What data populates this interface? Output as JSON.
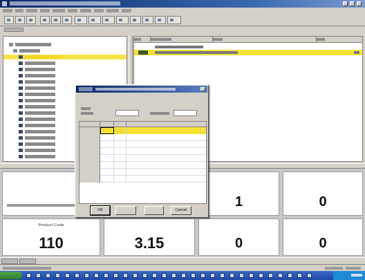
{
  "window": {
    "title": ""
  },
  "menu": {
    "items": [
      "",
      "",
      "",
      "",
      "",
      "",
      "",
      "",
      "",
      ""
    ]
  },
  "tree": {
    "root_label": "",
    "child_label": "",
    "items": [
      "",
      "",
      "",
      "",
      "",
      "",
      "",
      "",
      "",
      "",
      "",
      "",
      "",
      "",
      "",
      "",
      ""
    ],
    "selected_index": 0
  },
  "list": {
    "columns": [
      "",
      "",
      "",
      ""
    ],
    "rows": [
      {
        "text": "",
        "selected": false
      },
      {
        "text": "",
        "selected": true
      }
    ]
  },
  "panels": [
    {
      "title": "",
      "value": "",
      "subtitle": ""
    },
    {
      "title": "",
      "value": ""
    },
    {
      "title": "",
      "value": "1"
    },
    {
      "title": "",
      "value": "0"
    },
    {
      "title": "Product Code",
      "value": "110"
    },
    {
      "title": "",
      "value": "3.15"
    },
    {
      "title": "",
      "value": "0"
    },
    {
      "title": "",
      "value": "0"
    }
  ],
  "dialog": {
    "title": "",
    "label_address": "",
    "label_quantity": "",
    "address_value": "",
    "quantity_value": "",
    "grid": {
      "columns": [
        "",
        "",
        ""
      ],
      "row_labels": [
        "",
        "",
        "",
        "",
        "",
        "",
        "",
        ""
      ],
      "selected_row": 0
    },
    "buttons": {
      "ok": "OK",
      "second": "",
      "third": "",
      "cancel": "Cancel"
    }
  },
  "taskbar": {
    "start_label": "",
    "clock": ""
  },
  "colors": {
    "selection": "#f5e135",
    "titlebar": "#0a246a",
    "panel_bg": "#ffffff"
  }
}
